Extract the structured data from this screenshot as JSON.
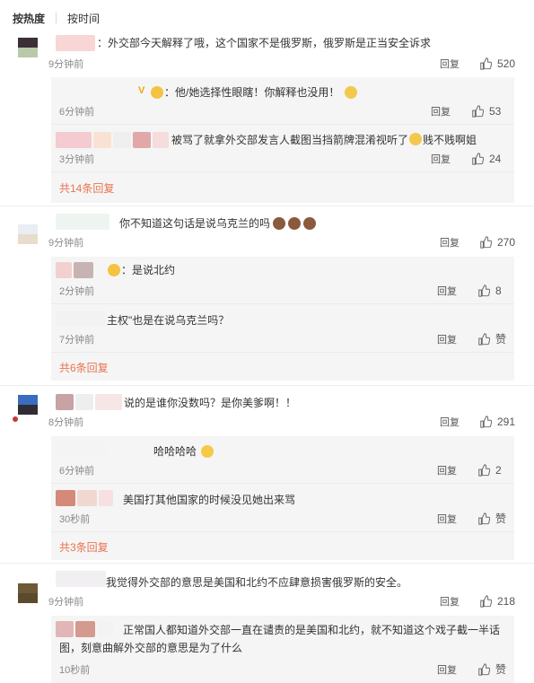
{
  "tabs": {
    "hot": "按热度",
    "time": "按时间"
  },
  "labels": {
    "reply": "回复",
    "zan": "赞"
  },
  "threads": [
    {
      "text": "：外交部今天解释了哦，这个国家不是俄罗斯，俄罗斯是正当安全诉求",
      "time": "9分钟前",
      "likes": "520",
      "replies": [
        {
          "text": "：他/她选择性眼瞎！你解释也没用！",
          "time": "6分钟前",
          "likes": "53"
        },
        {
          "text": "被骂了就拿外交部发言人截图当挡箭牌混淆视听了",
          "text2": "贱不贱啊姐",
          "time": "3分钟前",
          "likes": "24"
        }
      ],
      "more": "共14条回复"
    },
    {
      "text": "你不知道这句话是说乌克兰的吗",
      "time": "9分钟前",
      "likes": "270",
      "replies": [
        {
          "text": "：是说北约",
          "time": "2分钟前",
          "likes": "8"
        },
        {
          "text": "主权\"也是在说乌克兰吗？",
          "time": "7分钟前",
          "likes": "赞"
        }
      ],
      "more": "共6条回复"
    },
    {
      "text": "说的是谁你没数吗？是你美爹啊！！",
      "time": "8分钟前",
      "likes": "291",
      "replies": [
        {
          "text": "哈哈哈哈",
          "time": "6分钟前",
          "likes": "2"
        },
        {
          "text": "美国打其他国家的时候没见她出来骂",
          "time": "30秒前",
          "likes": "赞"
        }
      ],
      "more": "共3条回复"
    },
    {
      "text": "我觉得外交部的意思是美国和北约不应肆意损害俄罗斯的安全。",
      "time": "9分钟前",
      "likes": "218",
      "replies": [
        {
          "text": "正常国人都知道外交部一直在谴责的是美国和北约，就不知道这个戏子截一半话",
          "text2": "图，刻意曲解外交部的意思是为了什么",
          "time": "10秒前",
          "likes": "赞"
        }
      ]
    }
  ]
}
